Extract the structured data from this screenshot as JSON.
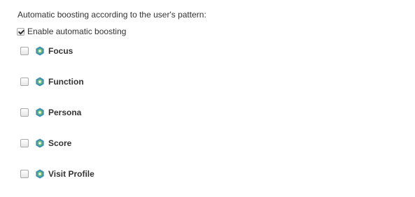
{
  "heading": "Automatic boosting according to the user's pattern:",
  "enable": {
    "label": "Enable automatic boosting",
    "checked": true
  },
  "facets": [
    {
      "label": "Focus",
      "checked": false,
      "icon": "facet-hexagon-icon"
    },
    {
      "label": "Function",
      "checked": false,
      "icon": "facet-hexagon-icon"
    },
    {
      "label": "Persona",
      "checked": false,
      "icon": "facet-hexagon-icon"
    },
    {
      "label": "Score",
      "checked": false,
      "icon": "facet-hexagon-icon"
    },
    {
      "label": "Visit Profile",
      "checked": false,
      "icon": "facet-hexagon-icon"
    }
  ],
  "colors": {
    "text": "#333333",
    "icon_outer": "#3b8fb5",
    "icon_inner": "#6fbf73"
  }
}
